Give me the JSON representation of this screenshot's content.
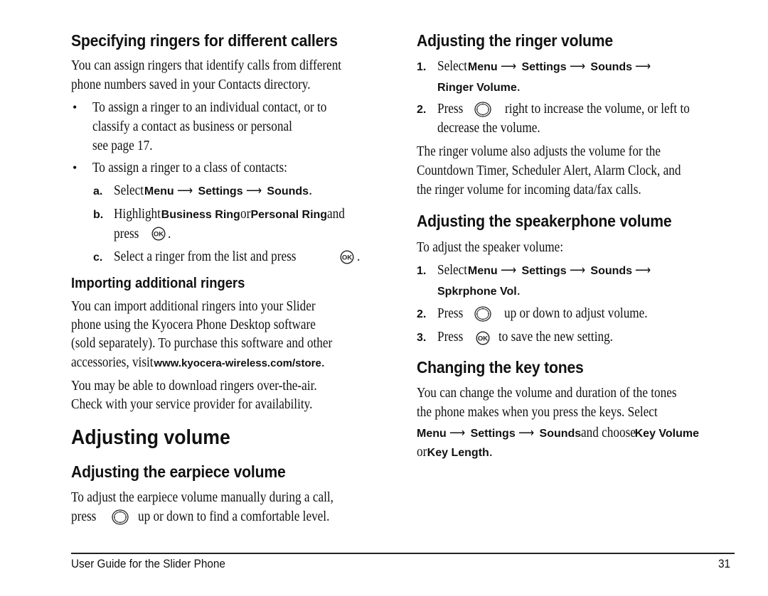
{
  "left": {
    "section1": {
      "heading": "Specifying ringers for different callers",
      "intro_line1": "You can assign ringers that identify calls from different",
      "intro_line2": "phone numbers saved in your Contacts directory.",
      "bullet1_line1": "To assign a ringer to an individual contact, or to",
      "bullet1_line2": "classify a contact as business or personal",
      "bullet1_line3": "see page 17.",
      "bullet2": "To assign a ringer to a class of contacts:",
      "steps": [
        {
          "label": "a.",
          "pre": "Select ",
          "path": [
            "Menu",
            "Settings",
            "Sounds"
          ],
          "post": "."
        },
        {
          "label": "b.",
          "pre": "Highlight ",
          "opt1": "Business Ring",
          "mid": " or ",
          "opt2": "Personal Ring",
          "post": " and",
          "line2_pre": "press",
          "line2_post": "."
        },
        {
          "label": "c.",
          "pre": "Select a ringer from the list and press",
          "post": "."
        }
      ]
    },
    "section2": {
      "heading": "Importing additional ringers",
      "p1_line1": "You can import additional ringers into your Slider",
      "p1_line2": "phone using the Kyocera Phone Desktop software",
      "p1_line3": "(sold separately). To purchase this software and other",
      "p1_line4_pre": "accessories, visit ",
      "p1_link": "www.kyocera-wireless.com/store",
      "p1_line4_post": ".",
      "p2_line1": "You may be able to download ringers over-the-air.",
      "p2_line2": "Check with your service provider for availability."
    },
    "section3": {
      "heading": "Adjusting volume",
      "sub_heading": "Adjusting the earpiece volume",
      "line1": "To adjust the earpiece volume manually during a call,",
      "line2_pre": "press",
      "line2_post": "up or down to find a comfortable level."
    }
  },
  "right": {
    "ringer": {
      "heading": "Adjusting the ringer volume",
      "step1_label": "1.",
      "step1_pre": "Select ",
      "step1_path": [
        "Menu",
        "Settings",
        "Sounds",
        "Ringer Volume"
      ],
      "step2_label": "2.",
      "step2_pre": "Press",
      "step2_post": "right to increase the volume, or left to",
      "step2_line2": "decrease the volume.",
      "note_line1": "The ringer volume also adjusts the volume for the",
      "note_line2": "Countdown Timer, Scheduler Alert, Alarm Clock, and",
      "note_line3": "the ringer volume for incoming data/fax calls."
    },
    "speaker": {
      "heading": "Adjusting the speakerphone volume",
      "intro": "To adjust the speaker volume:",
      "step1_label": "1.",
      "step1_pre": "Select ",
      "step1_path": [
        "Menu",
        "Settings",
        "Sounds",
        "Spkrphone Vol"
      ],
      "step2_label": "2.",
      "step2_pre": "Press",
      "step2_post": "up or down to adjust volume.",
      "step3_label": "3.",
      "step3_pre": "Press",
      "step3_post": "to save the new setting."
    },
    "keytones": {
      "heading": "Changing the key tones",
      "line1": "You can change the volume and duration of the tones",
      "line2": "the phone makes when you press the keys. Select",
      "path": [
        "Menu",
        "Settings",
        "Sounds"
      ],
      "line3_mid": " and choose ",
      "opt1": "Key Volume",
      "line4_pre": "or ",
      "opt2": "Key Length",
      "line4_post": "."
    }
  },
  "footer": {
    "title": "User Guide for the Slider Phone",
    "page_number": "31"
  },
  "glyphs": {
    "arrow": "⟶",
    "bullet": "•",
    "ok_key": "OK"
  }
}
